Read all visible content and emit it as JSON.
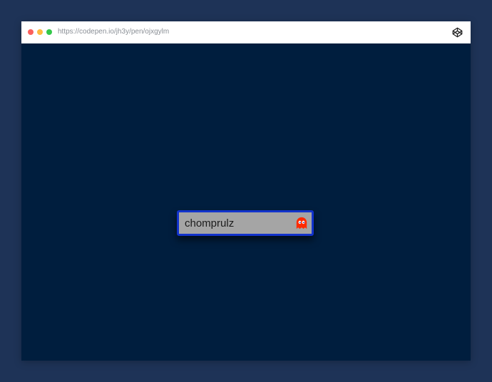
{
  "browser": {
    "url": "https://codepen.io/jh3y/pen/ojxgylm",
    "icons": {
      "close": "red-dot",
      "minimize": "yellow-dot",
      "maximize": "green-dot",
      "brand": "codepen-icon"
    }
  },
  "colors": {
    "page_bg": "#1e3357",
    "viewport_bg": "#001e3e",
    "input_border": "#1233cc",
    "input_bg": "#a5a5a5",
    "ghost": "#ff2a00",
    "dot_red": "#fc605c",
    "dot_yellow": "#fdbc40",
    "dot_green": "#34c84a"
  },
  "input": {
    "value": "chomprulz",
    "trailing_icon": "ghost-icon"
  }
}
